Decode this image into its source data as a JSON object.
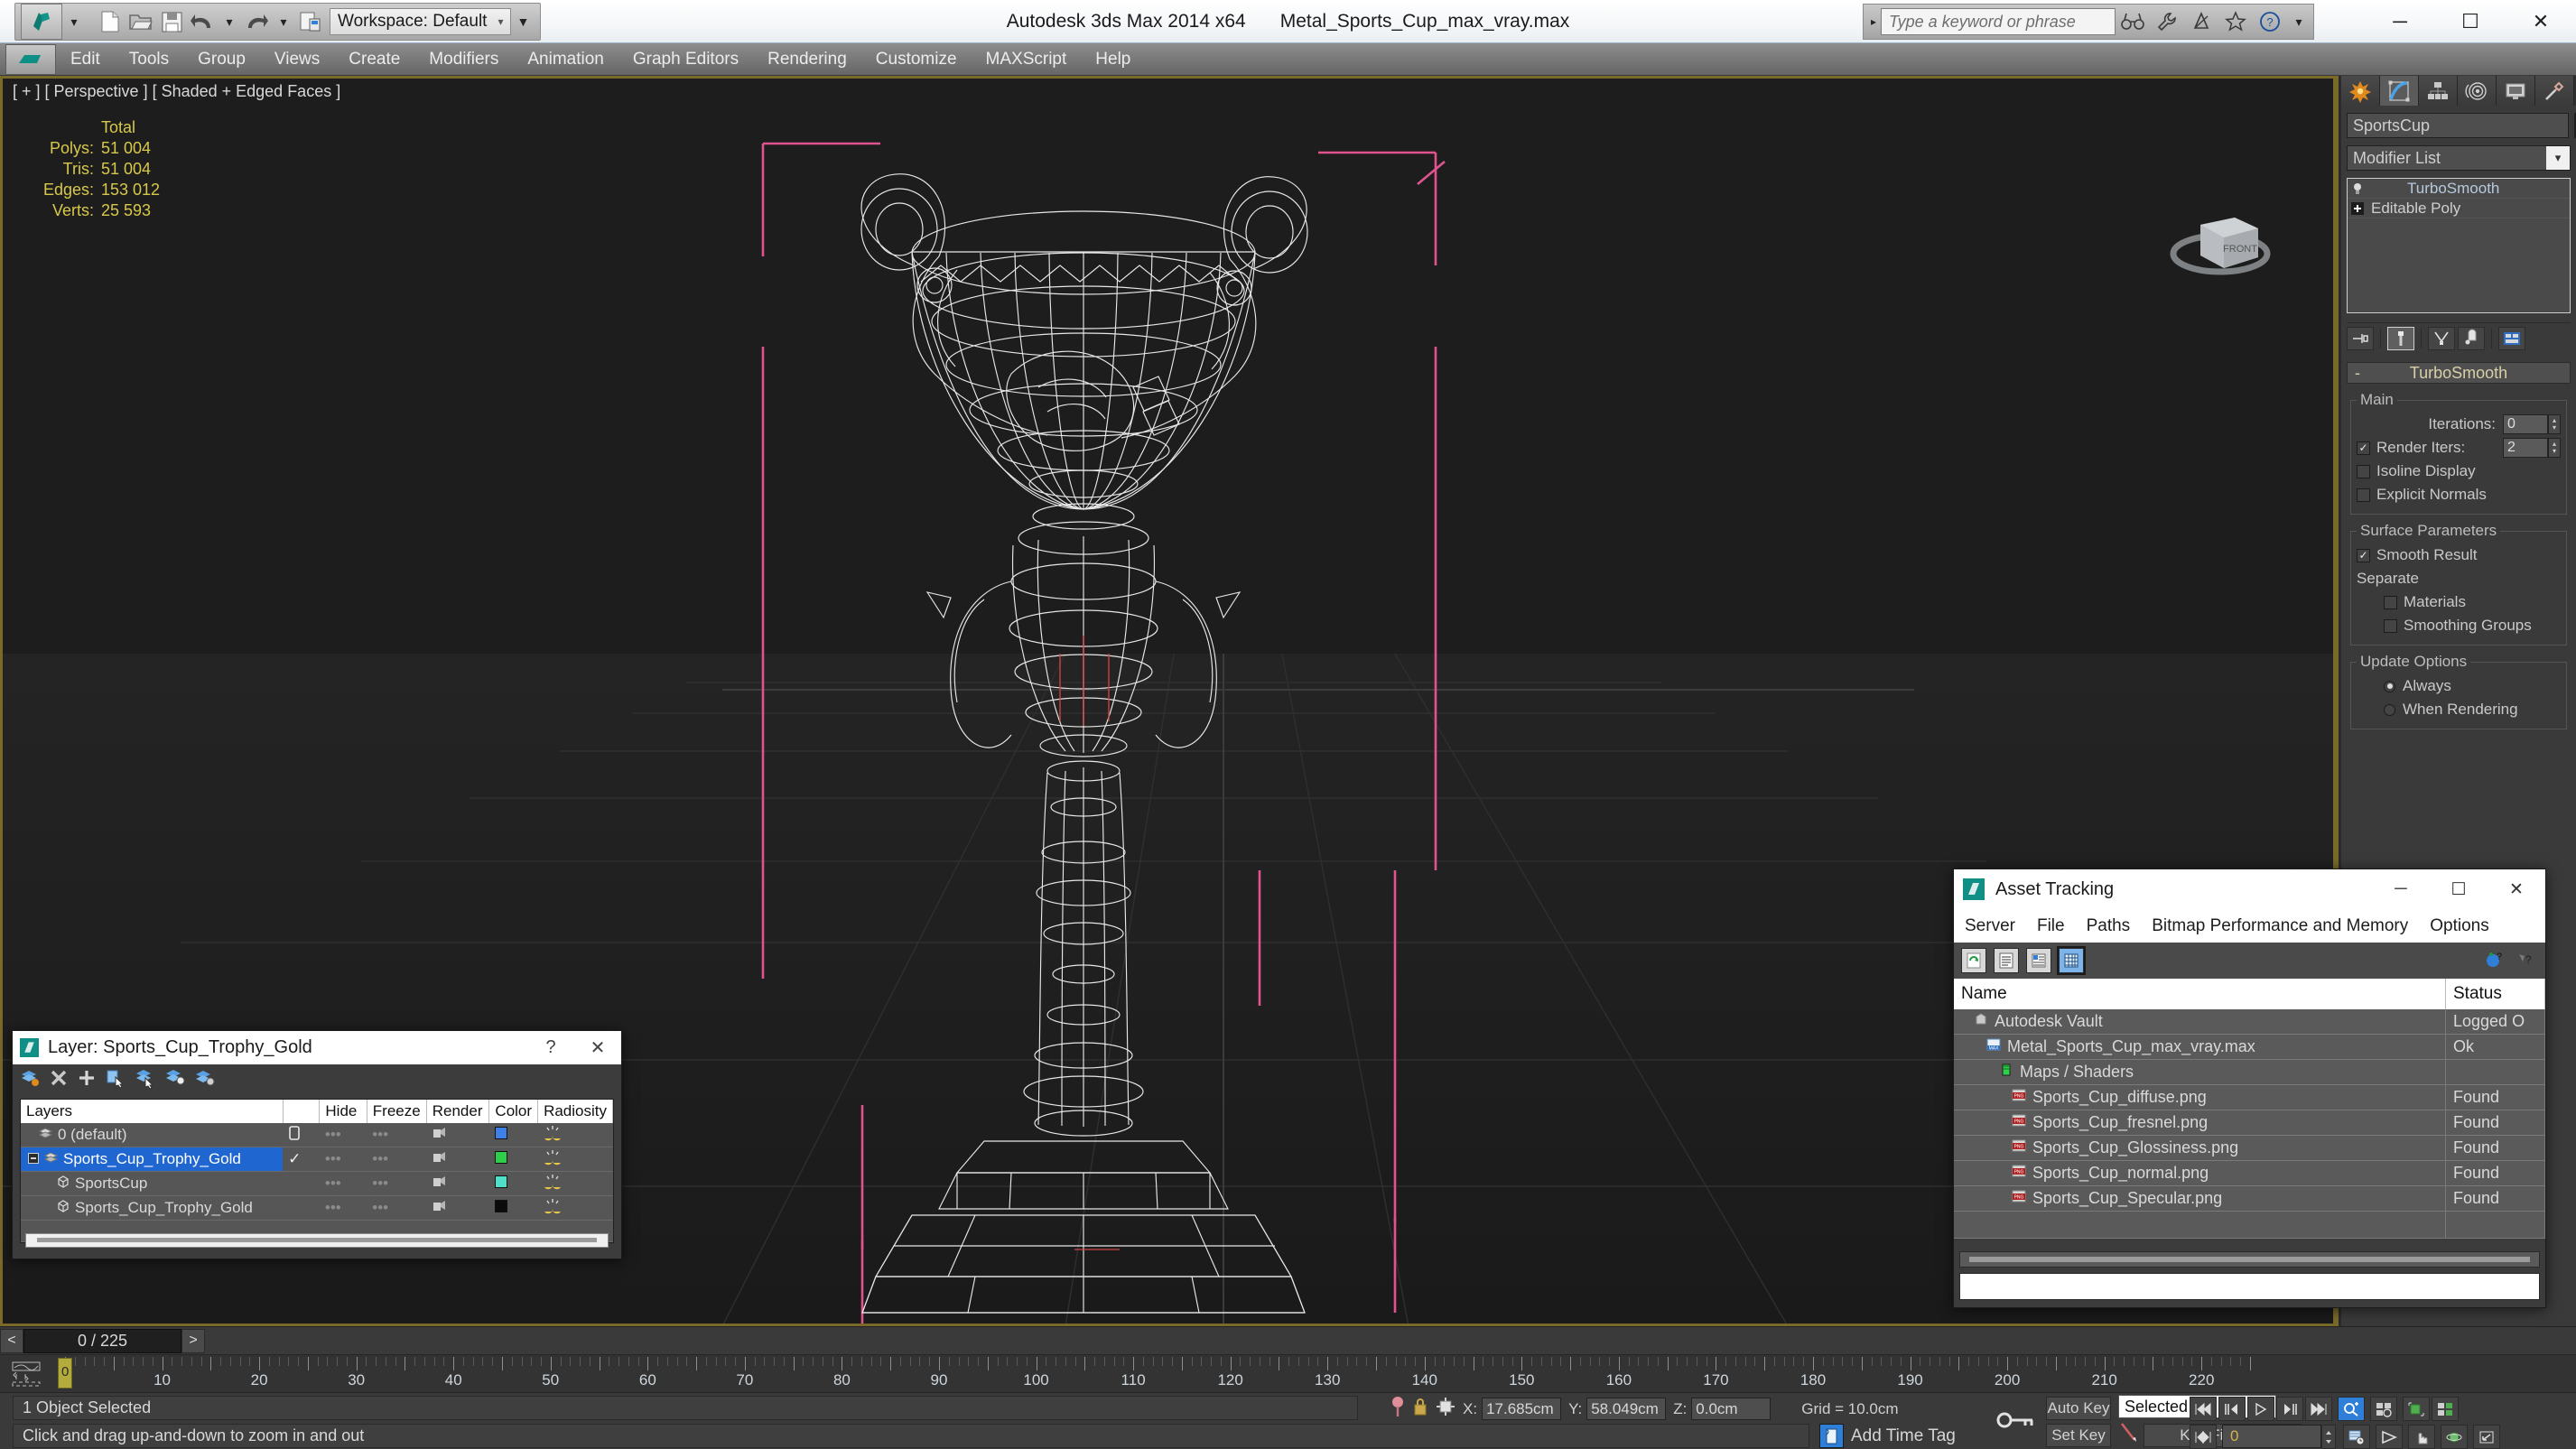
{
  "titlebar": {
    "app_title": "Autodesk 3ds Max  2014 x64",
    "file_title": "Metal_Sports_Cup_max_vray.max",
    "workspace_label": "Workspace: Default",
    "search_placeholder": "Type a keyword or phrase",
    "quick_access": [
      "new-file-icon",
      "open-file-icon",
      "save-file-icon",
      "undo-icon",
      "redo-icon",
      "project-folder-icon"
    ],
    "infocenter_icons": [
      "binoculars-icon",
      "wrench-icon",
      "subscription-icon",
      "favorites-star-icon",
      "help-icon"
    ],
    "window_buttons": [
      "minimize",
      "maximize",
      "close"
    ]
  },
  "menubar": {
    "items": [
      "Edit",
      "Tools",
      "Group",
      "Views",
      "Create",
      "Modifiers",
      "Animation",
      "Graph Editors",
      "Rendering",
      "Customize",
      "MAXScript",
      "Help"
    ]
  },
  "viewport": {
    "label": "[ + ] [ Perspective ] [ Shaded + Edged Faces ]",
    "stats": {
      "header": "Total",
      "rows": [
        {
          "label": "Polys:",
          "value": "51 004"
        },
        {
          "label": "Tris:",
          "value": "51 004"
        },
        {
          "label": "Edges:",
          "value": "153 012"
        },
        {
          "label": "Verts:",
          "value": "25 593"
        }
      ]
    },
    "viewcube_face": "FRONT"
  },
  "command_panel": {
    "tabs": [
      "create-tab",
      "modify-tab",
      "hierarchy-tab",
      "motion-tab",
      "display-tab",
      "utilities-tab"
    ],
    "active_tab_index": 1,
    "object_name": "SportsCup",
    "object_color": "#8fe3d2",
    "modifier_list_label": "Modifier List",
    "modifier_stack": [
      {
        "name": "TurboSmooth",
        "icon": "lightbulb-icon",
        "selected": true
      },
      {
        "name": "Editable Poly",
        "icon": "plus-box-icon",
        "selected": false
      }
    ],
    "stack_tools": [
      "pin-stack-icon",
      "show-end-result-icon",
      "make-unique-icon",
      "remove-modifier-icon",
      "configure-sets-icon"
    ],
    "rollout": {
      "title": "TurboSmooth",
      "collapse_glyph": "-",
      "main_group": "Main",
      "iterations_label": "Iterations:",
      "iterations_value": "0",
      "render_iters_label": "Render Iters:",
      "render_iters_value": "2",
      "render_iters_checked": true,
      "isoline_display_label": "Isoline Display",
      "isoline_display_checked": false,
      "explicit_normals_label": "Explicit Normals",
      "explicit_normals_checked": false,
      "surface_group": "Surface Parameters",
      "smooth_result_label": "Smooth Result",
      "smooth_result_checked": true,
      "separate_label": "Separate",
      "materials_label": "Materials",
      "materials_checked": false,
      "smoothing_groups_label": "Smoothing Groups",
      "smoothing_groups_checked": false,
      "update_group": "Update Options",
      "always_label": "Always",
      "when_rendering_label": "When Rendering",
      "update_selected": "Always"
    }
  },
  "asset_tracking": {
    "title": "Asset Tracking",
    "menu": [
      "Server",
      "File",
      "Paths",
      "Bitmap Performance and Memory",
      "Options"
    ],
    "toolbar_icons": [
      "refresh-icon",
      "list-view-icon",
      "details-view-icon",
      "grid-view-icon"
    ],
    "toolbar_right_icons": [
      "add-help-icon",
      "help-icon"
    ],
    "columns": [
      "Name",
      "Status"
    ],
    "rows": [
      {
        "name": "Autodesk Vault",
        "status": "Logged O",
        "icon": "vault-icon",
        "indent": 1
      },
      {
        "name": "Metal_Sports_Cup_max_vray.max",
        "status": "Ok",
        "icon": "max-file-icon",
        "indent": 2
      },
      {
        "name": "Maps / Shaders",
        "status": "",
        "icon": "maps-icon",
        "indent": 3
      },
      {
        "name": "Sports_Cup_diffuse.png",
        "status": "Found",
        "icon": "png-icon",
        "indent": 4
      },
      {
        "name": "Sports_Cup_fresnel.png",
        "status": "Found",
        "icon": "png-icon",
        "indent": 4
      },
      {
        "name": "Sports_Cup_Glossiness.png",
        "status": "Found",
        "icon": "png-icon",
        "indent": 4
      },
      {
        "name": "Sports_Cup_normal.png",
        "status": "Found",
        "icon": "png-icon",
        "indent": 4
      },
      {
        "name": "Sports_Cup_Specular.png",
        "status": "Found",
        "icon": "png-icon",
        "indent": 4
      }
    ]
  },
  "layer_window": {
    "title": "Layer: Sports_Cup_Trophy_Gold",
    "help_glyph": "?",
    "close_glyph": "✕",
    "toolbar_icons": [
      "create-layer-icon",
      "delete-layer-icon",
      "add-layer-icon",
      "select-objects-icon",
      "select-highlighted-icon",
      "add-selection-icon",
      "layer-properties-icon"
    ],
    "columns": [
      "Layers",
      "",
      "Hide",
      "Freeze",
      "Render",
      "Color",
      "Radiosity"
    ],
    "rows": [
      {
        "name": "0 (default)",
        "icon": "layer-icon",
        "current": "",
        "hide": "",
        "freeze": "",
        "render": "render-icon",
        "color": "#3f7fe8",
        "radiosity": "radiosity-icon",
        "indent": 1,
        "selected": false
      },
      {
        "name": "Sports_Cup_Trophy_Gold",
        "icon": "layer-icon",
        "current": "✓",
        "hide": "",
        "freeze": "",
        "render": "render-icon",
        "color": "#2ece4a",
        "radiosity": "radiosity-icon",
        "indent": 1,
        "selected": true,
        "expander": "-"
      },
      {
        "name": "SportsCup",
        "icon": "object-icon",
        "current": "",
        "hide": "",
        "freeze": "",
        "render": "render-icon",
        "color": "#4ee0c8",
        "radiosity": "radiosity-icon",
        "indent": 2,
        "selected": false
      },
      {
        "name": "Sports_Cup_Trophy_Gold",
        "icon": "object-icon",
        "current": "",
        "hide": "",
        "freeze": "",
        "render": "render-icon",
        "color": "#0b0b0b",
        "radiosity": "radiosity-icon",
        "indent": 2,
        "selected": false
      }
    ]
  },
  "time_slider": {
    "current_frame_label": "0 / 225",
    "prev_glyph": "<",
    "next_glyph": ">",
    "playhead_frame": "0"
  },
  "track_bar": {
    "tick_labels": [
      0,
      10,
      20,
      30,
      40,
      50,
      60,
      70,
      80,
      90,
      100,
      110,
      120,
      130,
      140,
      150,
      160,
      170,
      180,
      190,
      200,
      210,
      220
    ],
    "range_end": 225
  },
  "status_bar": {
    "selection_status": "1 Object Selected",
    "prompt": "Click and drag up-and-down to zoom in and out",
    "coords": [
      {
        "axis": "X:",
        "value": "17.685cm"
      },
      {
        "axis": "Y:",
        "value": "58.049cm"
      },
      {
        "axis": "Z:",
        "value": "0.0cm"
      }
    ],
    "grid_label": "Grid = 10.0cm",
    "add_time_tag": "Add Time Tag",
    "auto_key": "Auto Key",
    "set_key": "Set Key",
    "key_mode_selected": "Selected",
    "key_filters": "Key Filters...",
    "frame_field_value": "0",
    "lock_icon": "lock-icon",
    "pin_icon": "pin-icon",
    "absolute_mode_icon": "absolute-relative-icon",
    "key_icon": "key-icon",
    "playback_icons": [
      "goto-start-icon",
      "prev-frame-icon",
      "play-icon",
      "next-frame-icon",
      "goto-end-icon"
    ],
    "nav_icons": [
      "zoom-icon",
      "zoom-all-icon",
      "zoom-extents-icon",
      "zoom-extents-all-icon",
      "field-of-view-icon",
      "walkthrough-icon",
      "pan-icon",
      "orbit-icon",
      "maximize-viewport-icon"
    ]
  }
}
